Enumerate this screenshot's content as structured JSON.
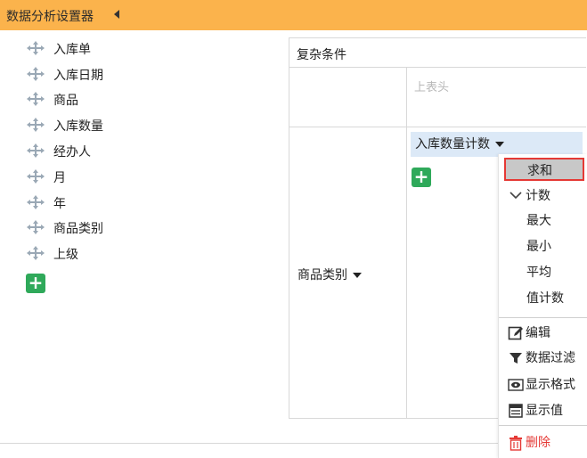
{
  "header": {
    "title": "数据分析设置器"
  },
  "fields": [
    "入库单",
    "入库日期",
    "商品",
    "入库数量",
    "经办人",
    "月",
    "年",
    "商品类别",
    "上级"
  ],
  "grid": {
    "condition_label": "复杂条件",
    "column_placeholder": "上表头",
    "row_dimension": "商品类别",
    "measure": "入库数量计数"
  },
  "menu": {
    "aggregations": {
      "sum": "求和",
      "count": "计数",
      "max": "最大",
      "min": "最小",
      "avg": "平均",
      "distinct_count": "值计数"
    },
    "actions": {
      "edit": "编辑",
      "filter": "数据过滤",
      "format": "显示格式",
      "show_value": "显示值",
      "delete": "删除"
    }
  },
  "colors": {
    "header_bg": "#fbb34c",
    "add_button": "#2fa95a",
    "measure_bg": "#dce9f7",
    "highlight_border": "#e53935",
    "delete_text": "#e53935"
  }
}
